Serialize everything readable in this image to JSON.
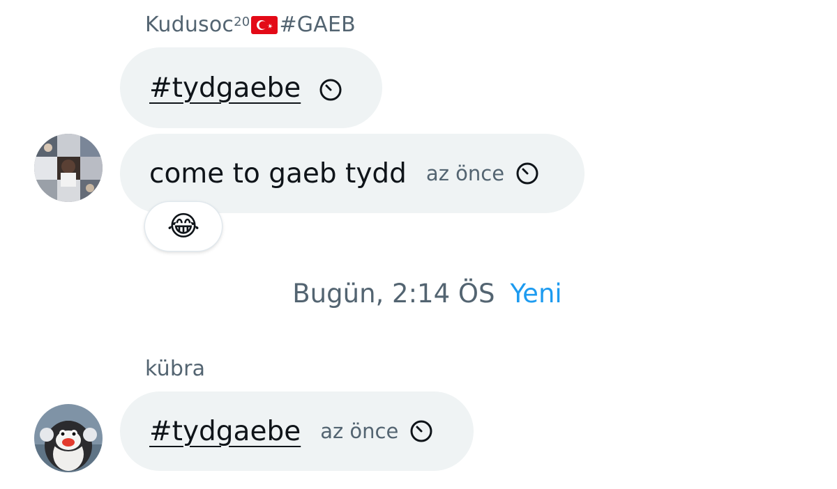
{
  "group1": {
    "sender_name": "Kudusoc",
    "sender_sup": "20",
    "sender_suffix": "#GAEB",
    "flag_icon": "turkey-flag-icon",
    "message1": {
      "hashtag": "#tydgaebe"
    },
    "message2": {
      "text": "come to gaeb tydd",
      "time": "az önce"
    },
    "reaction": "😂"
  },
  "divider": {
    "date": "Bugün, 2:14 ÖS",
    "new_label": "Yeni"
  },
  "group2": {
    "sender_name": "kübra",
    "message1": {
      "hashtag": "#tydgaebe",
      "time": "az önce"
    }
  },
  "colors": {
    "bubble": "#eff3f4",
    "muted": "#536471",
    "accent": "#1d9bf0",
    "text": "#0f1419"
  }
}
